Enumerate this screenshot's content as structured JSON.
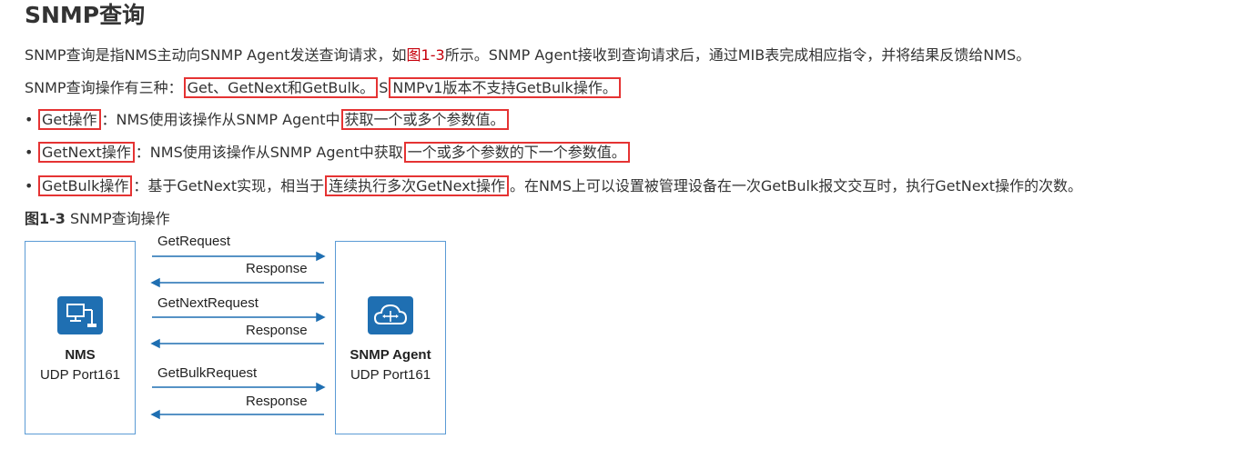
{
  "section": {
    "title": "SNMP查询",
    "p1_a": "SNMP查询是指NMS主动向SNMP Agent发送查询请求，如",
    "p1_link": "图1-3",
    "p1_b": "所示。SNMP Agent接收到查询请求后，通过MIB表完成相应指令，并将结果反馈给NMS。",
    "p2_a": "SNMP查询操作有三种：",
    "p2_hl1": "Get、GetNext和GetBulk。",
    "p2_b": "S",
    "p2_hl2": "NMPv1版本不支持GetBulk操作。",
    "bullets": [
      {
        "name_hl": "Get操作",
        "a": "：NMS使用该操作从SNMP Agent中",
        "hl": "获取一个或多个参数值。",
        "b": ""
      },
      {
        "name_hl": "GetNext操作",
        "a": "：NMS使用该操作从SNMP Agent中获取",
        "hl": "一个或多个参数的下一个参数值。",
        "b": ""
      },
      {
        "name_hl": "GetBulk操作",
        "a": "：基于GetNext实现，相当于",
        "hl": "连续执行多次GetNext操作",
        "b": "。在NMS上可以设置被管理设备在一次GetBulk报文交互时，执行GetNext操作的次数。"
      }
    ],
    "bullet_glyph": "•"
  },
  "figure": {
    "caption_num": "图1-3",
    "caption_text": " SNMP查询操作",
    "nms": {
      "name": "NMS",
      "port": "UDP Port161",
      "icon": "pc-network-icon"
    },
    "agent": {
      "name": "SNMP Agent",
      "port": "UDP Port161",
      "icon": "cloud-router-icon"
    },
    "messages": [
      {
        "label": "GetRequest",
        "direction": "to-agent"
      },
      {
        "label": "Response",
        "direction": "to-nms"
      },
      {
        "label": "GetNextRequest",
        "direction": "to-agent"
      },
      {
        "label": "Response",
        "direction": "to-nms"
      },
      {
        "label": "GetBulkRequest",
        "direction": "to-agent"
      },
      {
        "label": "Response",
        "direction": "to-nms"
      }
    ],
    "colors": {
      "box_border": "#5b9bd5",
      "icon_bg": "#1f6fb2",
      "arrow": "#1f6fb2",
      "highlight": "#e53333",
      "link": "#c7000b"
    }
  }
}
